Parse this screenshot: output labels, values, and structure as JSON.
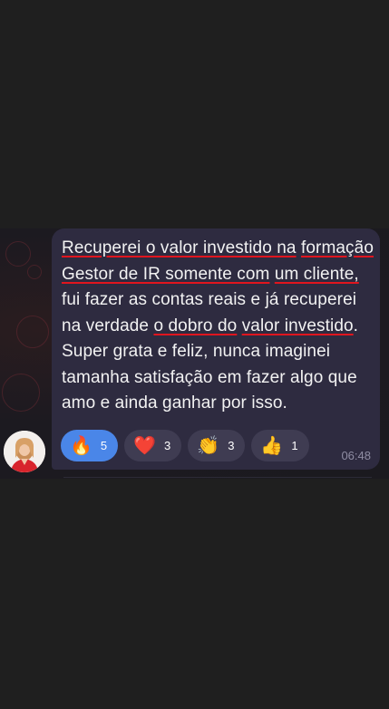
{
  "message": {
    "segments": [
      {
        "text": "Recuperei o valor investido na",
        "u": true
      },
      {
        "text": " ",
        "u": false
      },
      {
        "text": "formação Gestor de IR somente com",
        "u": true
      },
      {
        "text": " ",
        "u": false
      },
      {
        "text": "um cliente,",
        "u": true
      },
      {
        "text": " fui fazer as contas reais e já recuperei na verdade ",
        "u": false
      },
      {
        "text": "o dobro do",
        "u": true
      },
      {
        "text": " ",
        "u": false
      },
      {
        "text": "valor investido",
        "u": true
      },
      {
        "text": ". Super grata e feliz, nunca imaginei tamanha satisfação em fazer algo que amo e ainda ganhar por isso.",
        "u": false
      }
    ],
    "time": "06:48"
  },
  "reactions": [
    {
      "icon": "fire-icon",
      "emoji": "🔥",
      "count": "5",
      "active": true
    },
    {
      "icon": "heart-icon",
      "emoji": "❤️",
      "count": "3",
      "active": false
    },
    {
      "icon": "clapping-hands-icon",
      "emoji": "👏",
      "count": "3",
      "active": false
    },
    {
      "icon": "thumbs-up-icon",
      "emoji": "👍",
      "count": "1",
      "active": false
    }
  ],
  "colors": {
    "background": "#1f1f1f",
    "bubble": "#2e2b40",
    "reaction_active": "#4a86e8",
    "reaction": "#3f3c52",
    "underline": "#e0151e"
  }
}
